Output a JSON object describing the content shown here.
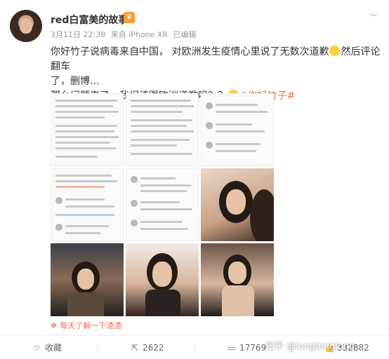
{
  "post": {
    "username": "red白富美的故事",
    "date": "3月11日 22:38",
    "device": "来自 iPhone XR",
    "edited": "已编辑",
    "text_line1": "你好竹子说病毒来自中国，  对欧洲发生疫情心里说了无数次道歉",
    "text_line1b": "然后评论翻车",
    "text_line2": "了，删博...",
    "text_line3": "那么问题来了，我们该跟欧洲道歉吗？？",
    "hashtag": "#你好竹子#",
    "source_text": "每天了解一下渣渣"
  },
  "actions": {
    "favorite": "收藏",
    "repost_count": "2622",
    "comment_count": "17769",
    "like_count": "332882"
  },
  "watermark": "知乎 @longlonglong",
  "icons": {
    "crown": "crown-badge-icon",
    "more": "chevron-down-icon",
    "favorite": "star-icon",
    "repost": "repost-icon",
    "comment": "comment-icon",
    "like": "thumb-up-icon",
    "source": "flower-icon"
  },
  "colors": {
    "accent": "#eb7350",
    "text": "#333333",
    "meta": "#999999"
  }
}
